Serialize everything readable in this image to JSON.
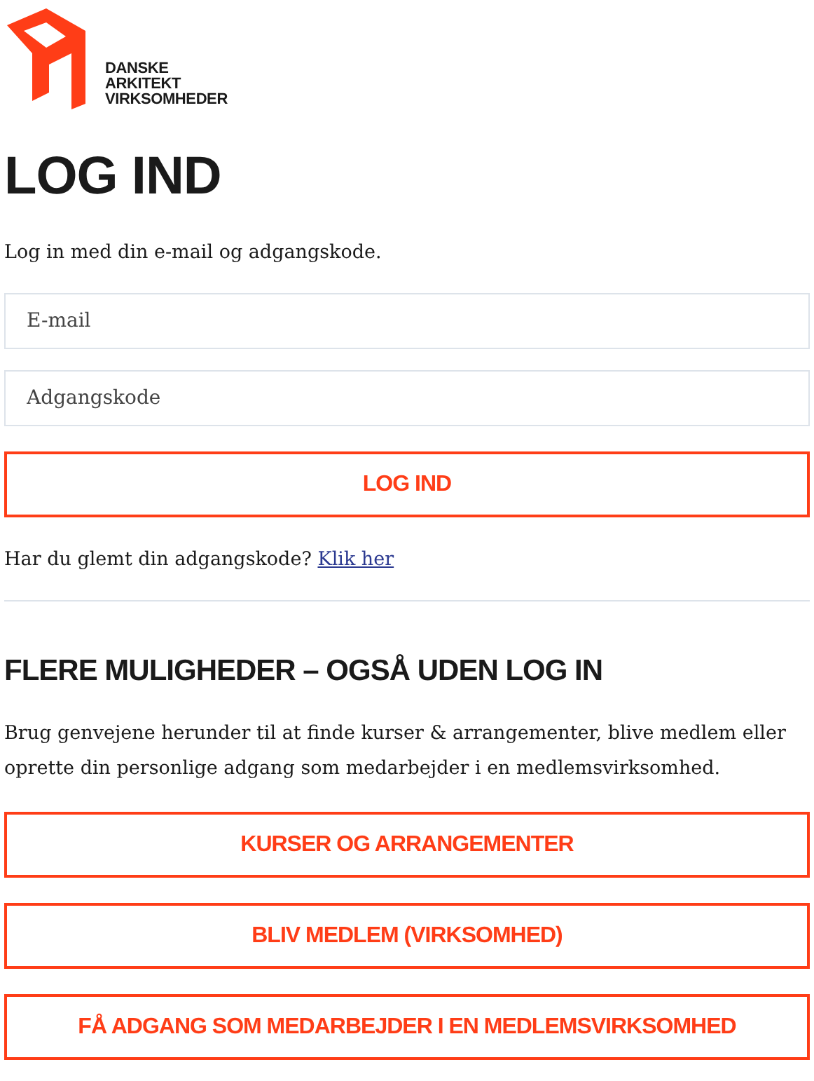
{
  "logo": {
    "lines": [
      "DANSKE",
      "ARKITEKT",
      "VIRKSOMHEDER"
    ]
  },
  "title": "LOG IND",
  "intro": "Log in med din e-mail og adgangskode.",
  "fields": [
    {
      "placeholder": "E-mail"
    },
    {
      "placeholder": "Adgangskode"
    }
  ],
  "submit": "LOG IND",
  "forgot": {
    "text": "Har du glemt din adgangskode?",
    "link": "Klik her"
  },
  "more": {
    "heading": "FLERE MULIGHEDER – OGSÅ UDEN LOG IN",
    "text": "Brug genvejene herunder til at finde kurser & arrangementer, blive medlem eller oprette din personlige adgang som medarbejder i en medlemsvirksomhed.",
    "buttons": [
      "KURSER OG ARRANGEMENTER",
      "BLIV MEDLEM (VIRKSOMHED)",
      "FÅ ADGANG SOM MEDARBEJDER I EN MEDLEMSVIRKSOMHED"
    ]
  }
}
